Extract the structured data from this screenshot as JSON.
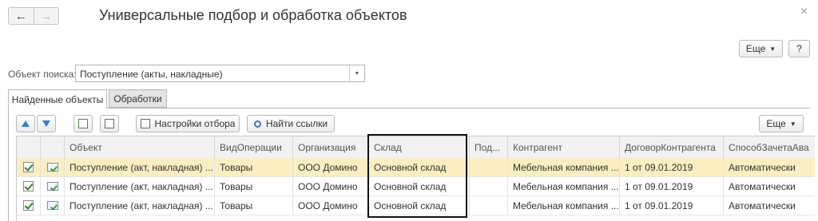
{
  "window": {
    "title": "Универсальные подбор и обработка объектов",
    "back_icon": "arrow-left-icon",
    "forward_icon": "arrow-right-icon",
    "close_icon": "close-icon"
  },
  "header_actions": {
    "more_label": "Еще",
    "help_label": "?"
  },
  "search": {
    "label": "Объект поиска:",
    "value": "Поступление (акты, накладные)"
  },
  "tabs": [
    {
      "label": "Найденные объекты",
      "active": true
    },
    {
      "label": "Обработки",
      "active": false
    }
  ],
  "toolbar": {
    "filter_settings_label": "Настройки отбора",
    "find_links_label": "Найти ссылки",
    "more_label": "Еще"
  },
  "table": {
    "columns": [
      "",
      "",
      "Объект",
      "ВидОперации",
      "Организация",
      "Склад",
      "Под...",
      "Контрагент",
      "ДоговорКонтрагента",
      "СпособЗачетаАва"
    ],
    "rows": [
      {
        "checked": true,
        "selected": true,
        "object": "Поступление (акт, накладная) ...",
        "operation": "Товары",
        "organization": "ООО Домино",
        "warehouse": "Основной склад",
        "sub": "",
        "counterparty": "Мебельная компания ...",
        "contract": "1 от 09.01.2019",
        "offset_method": "Автоматически"
      },
      {
        "checked": true,
        "selected": false,
        "object": "Поступление (акт, накладная) ...",
        "operation": "Товары",
        "organization": "ООО Домино",
        "warehouse": "Основной склад",
        "sub": "",
        "counterparty": "Мебельная компания ...",
        "contract": "1 от 09.01.2019",
        "offset_method": "Автоматически"
      },
      {
        "checked": true,
        "selected": false,
        "object": "Поступление (акт, накладная) ...",
        "operation": "Товары",
        "organization": "ООО Домино",
        "warehouse": "Основной склад",
        "sub": "",
        "counterparty": "Мебельная компания ...",
        "contract": "1 от 09.01.2019",
        "offset_method": "Автоматически"
      }
    ]
  },
  "colors": {
    "selected_row": "#fbeec1",
    "accent": "#2e7fd6",
    "check": "#2a8a2a"
  }
}
